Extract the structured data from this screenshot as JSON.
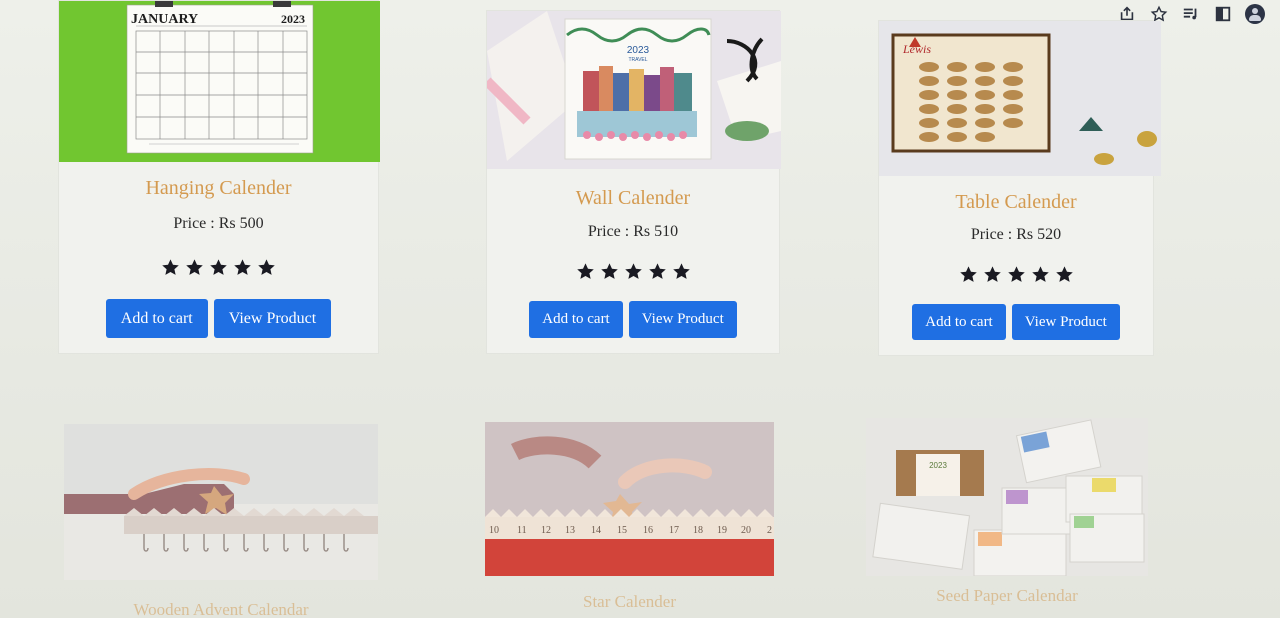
{
  "toolbar": {
    "icons": [
      "share-icon",
      "star-bookmark-icon",
      "reading-list-icon",
      "side-panel-icon",
      "profile-icon"
    ]
  },
  "products": [
    {
      "title": "Hanging Calender",
      "price": "Price : Rs 500",
      "rating": 5,
      "add_to_cart": "Add to cart",
      "view_product": "View Product",
      "image": {
        "month": "JANUARY",
        "year": "2023"
      }
    },
    {
      "title": "Wall Calender",
      "price": "Price : Rs 510",
      "rating": 5,
      "add_to_cart": "Add to cart",
      "view_product": "View Product",
      "image": {
        "year": "2023",
        "caption": "TRAVEL"
      }
    },
    {
      "title": "Table Calender",
      "price": "Price : Rs 520",
      "rating": 5,
      "add_to_cart": "Add to cart",
      "view_product": "View Product",
      "image": {
        "heading": "Lewis"
      }
    }
  ],
  "bottom_products": [
    {
      "title": "Wooden Advent Calendar"
    },
    {
      "title": "Star Calender",
      "image": {
        "numbers": [
          "10",
          "11",
          "12",
          "13",
          "14",
          "15",
          "16",
          "17",
          "18",
          "19",
          "20",
          "2"
        ]
      }
    },
    {
      "title": "Seed Paper Calendar",
      "image": {
        "year": "2023"
      }
    }
  ],
  "colors": {
    "button": "#1f6fe3",
    "title": "#d49a4f",
    "star": "#1a1a22",
    "background": "#e9ebe4"
  }
}
